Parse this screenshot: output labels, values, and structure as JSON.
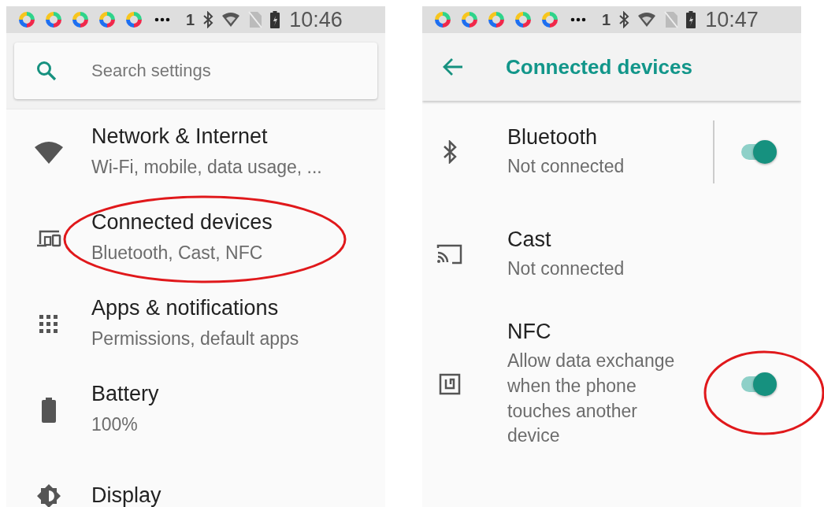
{
  "left_screen": {
    "status_bar": {
      "badge": "1",
      "time": "10:46"
    },
    "search": {
      "placeholder": "Search settings"
    },
    "items": [
      {
        "kind": "wifi",
        "title": "Network & Internet",
        "subtitle": "Wi-Fi, mobile, data usage, ..."
      },
      {
        "kind": "devices",
        "title": "Connected devices",
        "subtitle": "Bluetooth, Cast, NFC"
      },
      {
        "kind": "apps",
        "title": "Apps & notifications",
        "subtitle": "Permissions, default apps"
      },
      {
        "kind": "battery",
        "title": "Battery",
        "subtitle": "100%"
      },
      {
        "kind": "display",
        "title": "Display"
      }
    ]
  },
  "right_screen": {
    "status_bar": {
      "badge": "1",
      "time": "10:47"
    },
    "toolbar": {
      "title": "Connected devices"
    },
    "items": [
      {
        "kind": "bluetooth",
        "title": "Bluetooth",
        "subtitle": "Not connected",
        "toggle": true,
        "on": true,
        "divider": true
      },
      {
        "kind": "cast",
        "title": "Cast",
        "subtitle": "Not connected",
        "toggle": false
      },
      {
        "kind": "nfc",
        "title": "NFC",
        "subtitle": "Allow data exchange when the phone touches another device",
        "toggle": true,
        "on": true,
        "divider": false
      }
    ]
  }
}
